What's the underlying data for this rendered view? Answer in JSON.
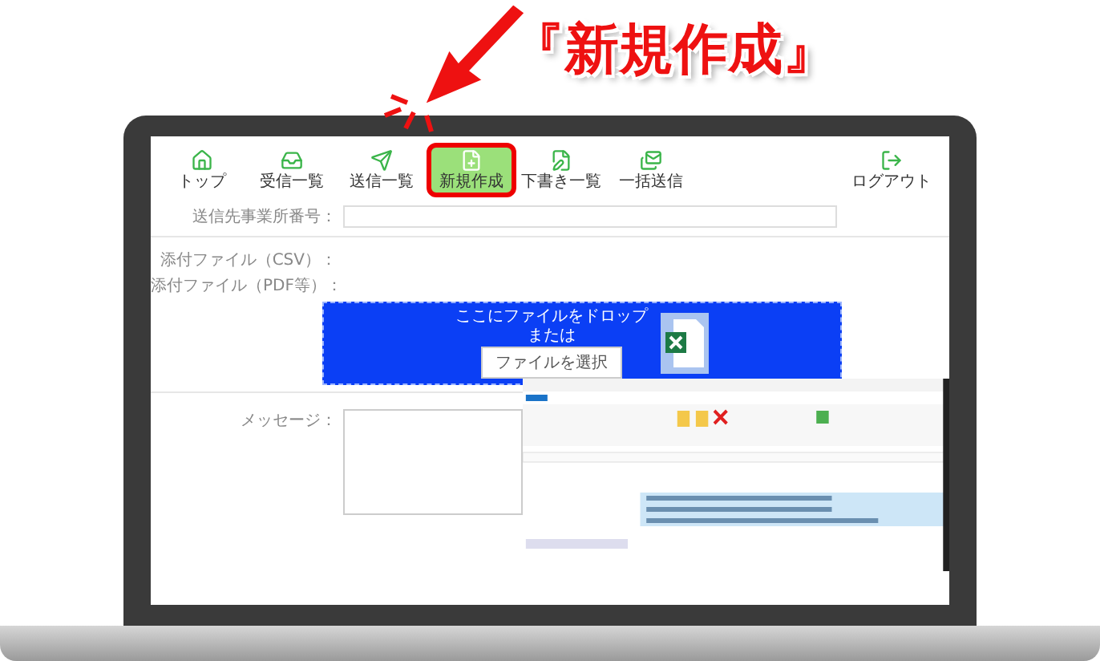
{
  "callout": {
    "text": "『新規作成』"
  },
  "toolbar": {
    "items": [
      {
        "kind": "home",
        "label": "トップ",
        "selected": false
      },
      {
        "kind": "inbox",
        "label": "受信一覧",
        "selected": false
      },
      {
        "kind": "sent",
        "label": "送信一覧",
        "selected": false
      },
      {
        "kind": "new",
        "label": "新規作成",
        "selected": true
      },
      {
        "kind": "draft",
        "label": "下書き一覧",
        "selected": false
      },
      {
        "kind": "bulk",
        "label": "一括送信",
        "selected": false
      }
    ],
    "logout": {
      "label": "ログアウト"
    }
  },
  "form": {
    "recipient_label": "送信先事業所番号：",
    "csv_label": "添付ファイル（CSV）：",
    "pdf_label": "添付ファイル（PDF等）：",
    "dropzone": {
      "hint": "ここにファイルをドロップ",
      "or": "または",
      "button": "ファイルを選択"
    },
    "message_label": "メッセージ："
  }
}
